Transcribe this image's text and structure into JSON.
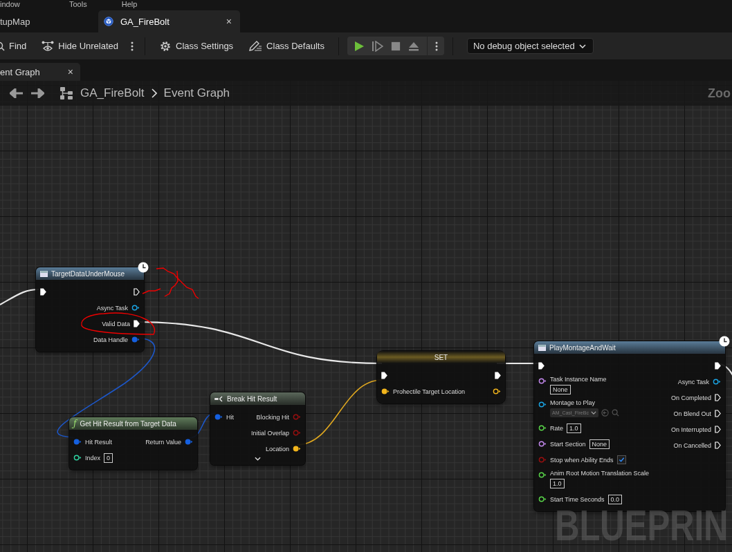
{
  "menu": [
    "indow",
    "Tools",
    "Help"
  ],
  "tabs": [
    {
      "label": "tupMap",
      "selected": false
    },
    {
      "label": "GA_FireBolt",
      "selected": true,
      "close": "×"
    }
  ],
  "toolbar": {
    "buttons": [
      {
        "label": "Find"
      },
      {
        "label": "Hide Unrelated"
      },
      {
        "label": "Class Settings"
      },
      {
        "label": "Class Defaults"
      }
    ],
    "debug_dropdown": "No debug object selected"
  },
  "doc_tab": {
    "label": "ent Graph",
    "close": "×"
  },
  "breadcrumb": [
    "GA_FireBolt",
    "Event Graph"
  ],
  "zoom_label": "Zoo",
  "nodes": [
    {
      "kind": "async",
      "title": "TargetDataUnderMouse",
      "latent": true,
      "inputs": [
        {
          "kind": "exec",
          "connected": true
        }
      ],
      "outputs": [
        {
          "kind": "exec",
          "connected": false
        },
        {
          "label": "Async Task",
          "kind": "object",
          "connected": false
        },
        {
          "label": "Valid Data",
          "kind": "exec",
          "connected": true
        },
        {
          "label": "Data Handle",
          "kind": "struct",
          "connected": true
        }
      ]
    },
    {
      "kind": "function",
      "title": "Get Hit Result from Target Data",
      "glyph": "ƒ",
      "latent": false,
      "inputs": [
        {
          "label": "Hit Result",
          "kind": "struct",
          "connected": true
        },
        {
          "label": "Index",
          "kind": "int",
          "connected": false,
          "field": {
            "kind": "text",
            "text": "0"
          }
        }
      ],
      "outputs": [
        {
          "label": "Return Value",
          "kind": "struct",
          "connected": true
        }
      ]
    },
    {
      "kind": "break",
      "title": "Break Hit Result",
      "latent": false,
      "expandable": true,
      "inputs": [
        {
          "label": "Hit",
          "kind": "struct",
          "connected": true
        }
      ],
      "outputs": [
        {
          "label": "Blocking Hit",
          "kind": "bool",
          "connected": false
        },
        {
          "label": "Initial Overlap",
          "kind": "bool",
          "connected": false
        },
        {
          "label": "Location",
          "kind": "vector",
          "connected": true
        }
      ]
    },
    {
      "kind": "set",
      "title": "SET",
      "latent": false,
      "inputs": [
        {
          "kind": "exec",
          "connected": true
        },
        {
          "label": "Prohectile Target Location",
          "kind": "vector",
          "connected": true
        }
      ],
      "outputs": [
        {
          "kind": "exec",
          "connected": true
        },
        {
          "kind": "vector",
          "connected": false
        }
      ]
    },
    {
      "kind": "async",
      "title": "PlayMontageAndWait",
      "latent": true,
      "inputs": [
        {
          "kind": "exec",
          "connected": true
        },
        {
          "label": "Task Instance Name",
          "kind": "name",
          "connected": false,
          "field": {
            "kind": "text",
            "text": "None"
          },
          "stacked": true
        },
        {
          "label": "Montage to Play",
          "kind": "object",
          "connected": false,
          "field": {
            "kind": "dropdown",
            "text": "AM_Cast_FireBc"
          },
          "stacked": true
        },
        {
          "label": "Rate",
          "kind": "float",
          "connected": false,
          "field": {
            "kind": "text",
            "text": "1.0"
          }
        },
        {
          "label": "Start Section",
          "kind": "name",
          "connected": false,
          "field": {
            "kind": "text",
            "text": "None"
          }
        },
        {
          "label": "Stop when Ability Ends",
          "kind": "bool",
          "connected": false,
          "field": {
            "kind": "checkbox",
            "checked": true
          }
        },
        {
          "label": "Anim Root Motion Translation Scale",
          "kind": "float",
          "connected": false,
          "field": {
            "kind": "text",
            "text": "1.0"
          },
          "stacked": true
        },
        {
          "label": "Start Time Seconds",
          "kind": "float",
          "connected": false,
          "field": {
            "kind": "text",
            "text": "0.0"
          }
        }
      ],
      "outputs": [
        {
          "kind": "exec",
          "connected": true
        },
        {
          "label": "Async Task",
          "kind": "object",
          "connected": false
        },
        {
          "label": "On Completed",
          "kind": "exec",
          "connected": false
        },
        {
          "label": "On Blend Out",
          "kind": "exec",
          "connected": false
        },
        {
          "label": "On Interrupted",
          "kind": "exec",
          "connected": false
        },
        {
          "label": "On Cancelled",
          "kind": "exec",
          "connected": false
        }
      ]
    }
  ],
  "watermark": "BLUEPRIN"
}
